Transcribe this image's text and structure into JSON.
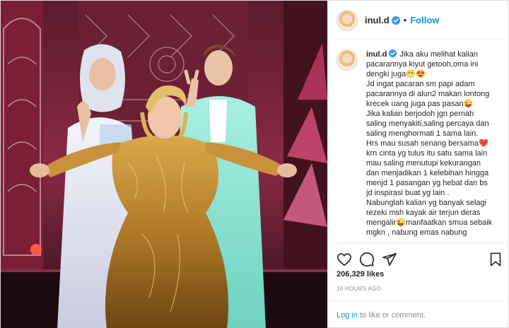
{
  "post": {
    "username": "inul.d",
    "follow_label": "Follow",
    "separator": "•",
    "caption_lines": [
      "Jika aku melihat kalian",
      "pacarannya kiyut getooh,oma ini",
      "dengki juga😁😍",
      "Jd ingat pacaran sm papi adam",
      "pacarannya di alun2 makan lontong",
      "krecek uang juga pas pasan😜",
      "Jika kalian berjodoh jgn pernah",
      "saling menyakiti,saling percaya dan",
      "saling menghormati 1 sama lain.",
      "Hrs mau susah senang bersama❤️",
      "krn cinta yg tulus itu satu sama lain",
      "mau saling menutupi kekurangan",
      "dan menjadikan 1 kelebihan hingga",
      "menjd 1 pasangan yg hebat dan bs",
      "jd inspirasi buat yg lain .",
      "Nabunglah kalian yg banyak selagi",
      "rezeki msh kayak air terjun deras",
      "mengalir😜manfaatkan smua sebaik",
      "mgkn , nabung emas nabung"
    ],
    "likes": "206,329 likes",
    "timestamp": "18 HOURS AGO",
    "login_link": "Log in",
    "login_suffix": " to like or comment."
  },
  "icons": {
    "verified": "verified-badge-icon",
    "like": "heart-icon",
    "comment": "comment-icon",
    "share": "paper-plane-icon",
    "save": "bookmark-icon"
  },
  "colors": {
    "link_blue": "#0095f6",
    "text": "#262626",
    "muted": "#8e8e8e",
    "border": "#efefef"
  }
}
